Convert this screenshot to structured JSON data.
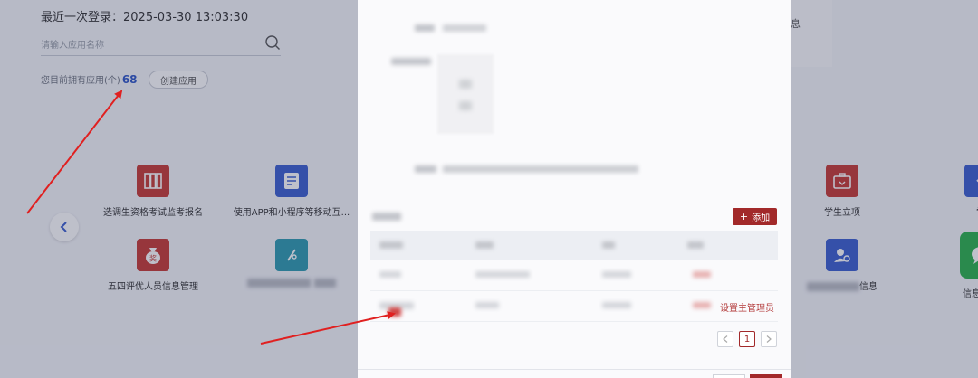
{
  "header": {
    "last_login_label": "最近一次登录：",
    "last_login_time": "2025-03-30 13:03:30"
  },
  "search": {
    "placeholder": "请输入应用名称"
  },
  "summary": {
    "app_count_label": "您目前拥有应用(个)",
    "app_count": "68",
    "create_button": "创建应用"
  },
  "apps": [
    {
      "label": "选调生资格考试监考报名",
      "icon": "archive-binders-icon",
      "color": "#c83a34"
    },
    {
      "label": "使用APP和小程序等移动互...",
      "icon": "document-form-icon",
      "color": "#3b5fd0"
    },
    {
      "label": "五四评优人员信息管理",
      "icon": "award-bag-icon",
      "color": "#c83a34"
    },
    {
      "label": "",
      "icon": "pen-edit-icon",
      "color": "#2e9bb0"
    },
    {
      "label": "学生立项",
      "icon": "briefcase-icon",
      "color": "#c83a34"
    },
    {
      "label": "学",
      "icon": "download-icon",
      "color": "#3b5fd0"
    },
    {
      "label": "信息",
      "icon": "user-settings-icon",
      "color": "#3b5fd0"
    },
    {
      "label": "信息化需",
      "icon": "chat-bubble-icon",
      "color": "#2bb24c"
    }
  ],
  "notice": {
    "text": "息"
  },
  "modal": {
    "add_button": "添加",
    "row_action": "设置主管理员",
    "current_page": "1"
  },
  "colors": {
    "brand": "#a2292a",
    "accent_blue": "#2f57c8"
  }
}
